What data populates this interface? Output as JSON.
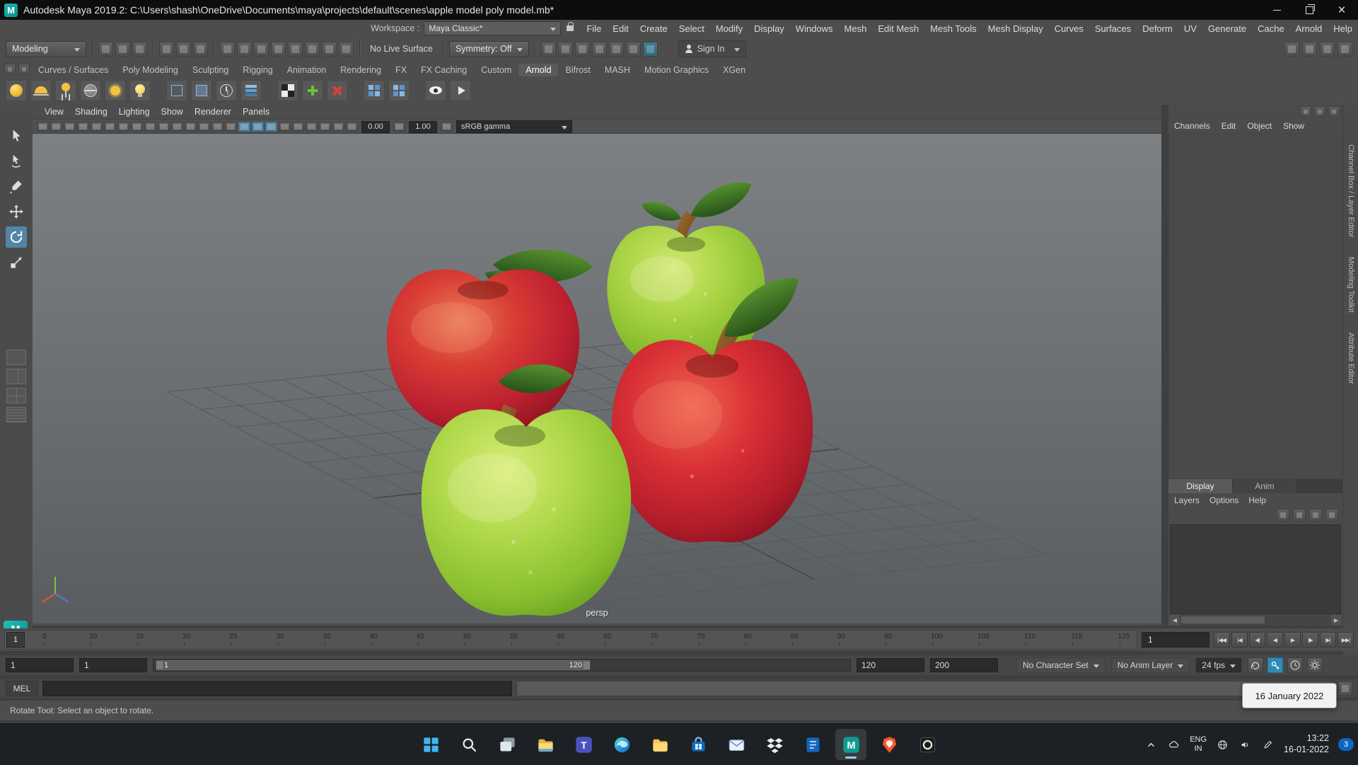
{
  "titlebar": {
    "logo_glyph": "M",
    "title": "Autodesk Maya 2019.2: C:\\Users\\shash\\OneDrive\\Documents\\maya\\projects\\default\\scenes\\apple model poly model.mb*"
  },
  "menubar": {
    "items": [
      "File",
      "Edit",
      "Create",
      "Select",
      "Modify",
      "Display",
      "Windows",
      "Mesh",
      "Edit Mesh",
      "Mesh Tools",
      "Mesh Display",
      "Curves",
      "Surfaces",
      "Deform",
      "UV",
      "Generate",
      "Cache",
      "Arnold",
      "Help"
    ],
    "workspace_label": "Workspace :",
    "workspace_value": "Maya Classic*"
  },
  "statusline": {
    "mode": "Modeling",
    "live_surface": "No Live Surface",
    "symmetry": "Symmetry: Off",
    "sign_in": "Sign In",
    "file_icons": [
      {
        "name": "new-scene"
      },
      {
        "name": "open-scene"
      },
      {
        "name": "save-scene"
      }
    ],
    "select_icons": [
      {
        "name": "undo"
      },
      {
        "name": "redo"
      },
      {
        "name": "select-mask"
      }
    ],
    "snap_icons": [
      {
        "name": "snap-to-grid"
      },
      {
        "name": "snap-to-curve"
      },
      {
        "name": "snap-to-point"
      },
      {
        "name": "snap-to-projected-center"
      },
      {
        "name": "snap-to-view-plane"
      },
      {
        "name": "make-live"
      },
      {
        "name": "input-connections"
      },
      {
        "name": "output-connections"
      }
    ],
    "render_icons": [
      {
        "name": "open-render-view"
      },
      {
        "name": "snapshot-render"
      },
      {
        "name": "ipr-render"
      },
      {
        "name": "render-settings"
      },
      {
        "name": "hypershade"
      },
      {
        "name": "light-editor"
      },
      {
        "name": "pause-viewport",
        "cls": "accent"
      }
    ],
    "right_icons": [
      {
        "name": "toggle-modeling-toolkit"
      },
      {
        "name": "toggle-attribute-editor"
      },
      {
        "name": "toggle-tool-settings"
      },
      {
        "name": "toggle-channel-box"
      }
    ]
  },
  "shelf": {
    "mini_icons": [
      {
        "name": "shelf-options-gear"
      },
      {
        "name": "shelf-tabs-toggle"
      }
    ],
    "tabs": [
      {
        "label": "Curves / Surfaces"
      },
      {
        "label": "Poly Modeling"
      },
      {
        "label": "Sculpting"
      },
      {
        "label": "Rigging"
      },
      {
        "label": "Animation"
      },
      {
        "label": "Rendering"
      },
      {
        "label": "FX"
      },
      {
        "label": "FX Caching"
      },
      {
        "label": "Custom"
      },
      {
        "label": "Arnold",
        "cls": "active"
      },
      {
        "label": "Bifrost"
      },
      {
        "label": "MASH"
      },
      {
        "label": "Motion Graphics"
      },
      {
        "label": "XGen"
      }
    ],
    "icons": [
      {
        "name": "arnold-area-light",
        "cls": "y-sphere",
        "inter": "true"
      },
      {
        "name": "arnold-skydome-light",
        "cls": "y-dome",
        "inter": "true"
      },
      {
        "name": "arnold-mesh-light",
        "cls": "y-tripod",
        "inter": "true"
      },
      {
        "name": "arnold-photometric-light",
        "cls": "g-globe",
        "inter": "true"
      },
      {
        "name": "arnold-light-portal",
        "cls": "y-sun",
        "inter": "true"
      },
      {
        "name": "arnold-physical-sky",
        "cls": "y-bulb",
        "inter": "true"
      },
      {
        "name": "shelf-separator",
        "cls": "sep",
        "inter": "false"
      },
      {
        "name": "arnold-standin",
        "cls": "b-cube",
        "inter": "true"
      },
      {
        "name": "arnold-volume",
        "cls": "b-box",
        "inter": "true"
      },
      {
        "name": "arnold-flush-cache",
        "cls": "clock",
        "inter": "true"
      },
      {
        "name": "arnold-scene-export",
        "cls": "b-layers",
        "inter": "true"
      },
      {
        "name": "shelf-separator",
        "cls": "sep",
        "inter": "false"
      },
      {
        "name": "arnold-tx-manager",
        "cls": "checker",
        "inter": "true"
      },
      {
        "name": "arnold-add-utility",
        "cls": "green-plus",
        "inter": "true"
      },
      {
        "name": "arnold-remove-utility",
        "cls": "red-x",
        "inter": "true"
      },
      {
        "name": "shelf-separator",
        "cls": "sep",
        "inter": "false"
      },
      {
        "name": "arnold-bake-geometry",
        "cls": "b-grid",
        "inter": "true"
      },
      {
        "name": "arnold-export-ass",
        "cls": "b-grid",
        "inter": "true"
      },
      {
        "name": "shelf-separator",
        "cls": "sep",
        "inter": "false"
      },
      {
        "name": "arnold-render-view",
        "cls": "eye",
        "inter": "true"
      },
      {
        "name": "arnold-render",
        "cls": "play",
        "inter": "true"
      }
    ]
  },
  "toolbox": {
    "tools": [
      {
        "name": "select-tool"
      },
      {
        "name": "lasso-tool"
      },
      {
        "name": "paint-select-tool"
      },
      {
        "name": "move-tool"
      },
      {
        "name": "rotate-tool",
        "cls": "active"
      },
      {
        "name": "scale-tool"
      }
    ],
    "layouts": [
      {
        "name": "layout-single-pane",
        "cls": ""
      },
      {
        "name": "layout-two-pane",
        "cls": "two"
      },
      {
        "name": "layout-four-pane",
        "cls": "four"
      },
      {
        "name": "layout-outliner-persp",
        "cls": "outliner"
      }
    ]
  },
  "viewport": {
    "menus": [
      "View",
      "Shading",
      "Lighting",
      "Show",
      "Renderer",
      "Panels"
    ],
    "toolbar_icons": [
      {
        "name": "select-camera"
      },
      {
        "name": "lock-camera"
      },
      {
        "name": "camera-attributes"
      },
      {
        "name": "bookmarks"
      },
      {
        "name": "image-plane"
      },
      {
        "name": "2d-pan-zoom"
      },
      {
        "name": "grease-pencil"
      },
      {
        "name": "grid-toggle"
      },
      {
        "name": "film-gate"
      },
      {
        "name": "resolution-gate"
      },
      {
        "name": "gate-mask"
      },
      {
        "name": "field-chart"
      },
      {
        "name": "safe-action"
      },
      {
        "name": "safe-title"
      },
      {
        "name": "wireframe-mode"
      },
      {
        "name": "shaded-mode",
        "cls": "active"
      },
      {
        "name": "textured-mode",
        "cls": "active"
      },
      {
        "name": "use-all-lights",
        "cls": "active"
      },
      {
        "name": "shadows-toggle"
      },
      {
        "name": "screen-space-ao"
      },
      {
        "name": "motion-blur-toggle"
      },
      {
        "name": "multisample-aa"
      },
      {
        "name": "depth-peeling"
      },
      {
        "name": "isolate-select"
      }
    ],
    "exposure": "0.00",
    "gamma": "1.00",
    "colorspace": "sRGB gamma",
    "camera_label": "persp"
  },
  "scene": {
    "objects": [
      {
        "name": "apple-red-back",
        "color": "#c1242e"
      },
      {
        "name": "apple-green-back",
        "color": "#8fc636"
      },
      {
        "name": "apple-red-front",
        "color": "#b81f2b"
      },
      {
        "name": "apple-green-front",
        "color": "#8cc333"
      }
    ]
  },
  "channel_box": {
    "menus": [
      "Channels",
      "Edit",
      "Object",
      "Show"
    ],
    "mini_icons": [
      {
        "name": "manip-speed-slow"
      },
      {
        "name": "manip-speed-medium"
      },
      {
        "name": "manip-speed-fast"
      }
    ]
  },
  "layer_editor": {
    "tabs": [
      {
        "label": "Display",
        "cls": "active"
      },
      {
        "label": "Anim"
      }
    ],
    "menus": [
      "Layers",
      "Options",
      "Help"
    ],
    "icons": [
      {
        "name": "move-layer-up"
      },
      {
        "name": "move-layer-down"
      },
      {
        "name": "create-empty-layer"
      },
      {
        "name": "create-layer-from-selected"
      }
    ]
  },
  "side_tabs": [
    {
      "label": "Channel Box / Layer Editor"
    },
    {
      "label": "Modeling Toolkit"
    },
    {
      "label": "Attribute Editor"
    }
  ],
  "timeline": {
    "current_frame": "1",
    "ticks": [
      5,
      10,
      15,
      20,
      25,
      30,
      35,
      40,
      45,
      50,
      55,
      60,
      65,
      70,
      75,
      80,
      85,
      90,
      95,
      100,
      105,
      110,
      115,
      120
    ]
  },
  "playback": {
    "current_time": "1",
    "buttons": [
      {
        "name": "go-to-start"
      },
      {
        "name": "step-back-frame"
      },
      {
        "name": "step-back-key"
      },
      {
        "name": "play-backwards"
      },
      {
        "name": "play-forward"
      },
      {
        "name": "step-forward-key"
      },
      {
        "name": "step-forward-frame"
      },
      {
        "name": "go-to-end"
      }
    ]
  },
  "range_slider": {
    "anim_start": "1",
    "play_start": "1",
    "play_end": "120",
    "anim_end": "200",
    "range_start_label": "1",
    "range_end_label": "120",
    "character_set": "No Character Set",
    "anim_layer": "No Anim Layer",
    "fps": "24 fps",
    "icons": [
      {
        "name": "playback-loop",
        "cls": ""
      },
      {
        "name": "auto-keyframe",
        "cls": "active"
      },
      {
        "name": "playback-speed",
        "cls": ""
      },
      {
        "name": "animation-preferences",
        "cls": ""
      }
    ]
  },
  "command_line": {
    "label": "MEL"
  },
  "help_line": {
    "text": "Rotate Tool: Select an object to rotate."
  },
  "tooltip": {
    "text": "16 January 2022"
  },
  "taskbar": {
    "icons": [
      {
        "name": "start"
      },
      {
        "name": "search"
      },
      {
        "name": "task-view"
      },
      {
        "name": "file-explorer"
      },
      {
        "name": "teams"
      },
      {
        "name": "edge"
      },
      {
        "name": "folder"
      },
      {
        "name": "store"
      },
      {
        "name": "mail"
      },
      {
        "name": "dropbox"
      },
      {
        "name": "notebook"
      },
      {
        "name": "maya",
        "cls": "active"
      },
      {
        "name": "brave"
      },
      {
        "name": "audio-app"
      }
    ],
    "tray_icons_left": [
      {
        "name": "tray-chevron-up"
      },
      {
        "name": "tray-onedrive"
      }
    ],
    "tray_icons_right": [
      {
        "name": "tray-network"
      },
      {
        "name": "tray-volume"
      },
      {
        "name": "tray-pen"
      }
    ],
    "lang_top": "ENG",
    "lang_bottom": "IN",
    "time": "13:22",
    "date": "16-01-2022",
    "badge": "3"
  }
}
